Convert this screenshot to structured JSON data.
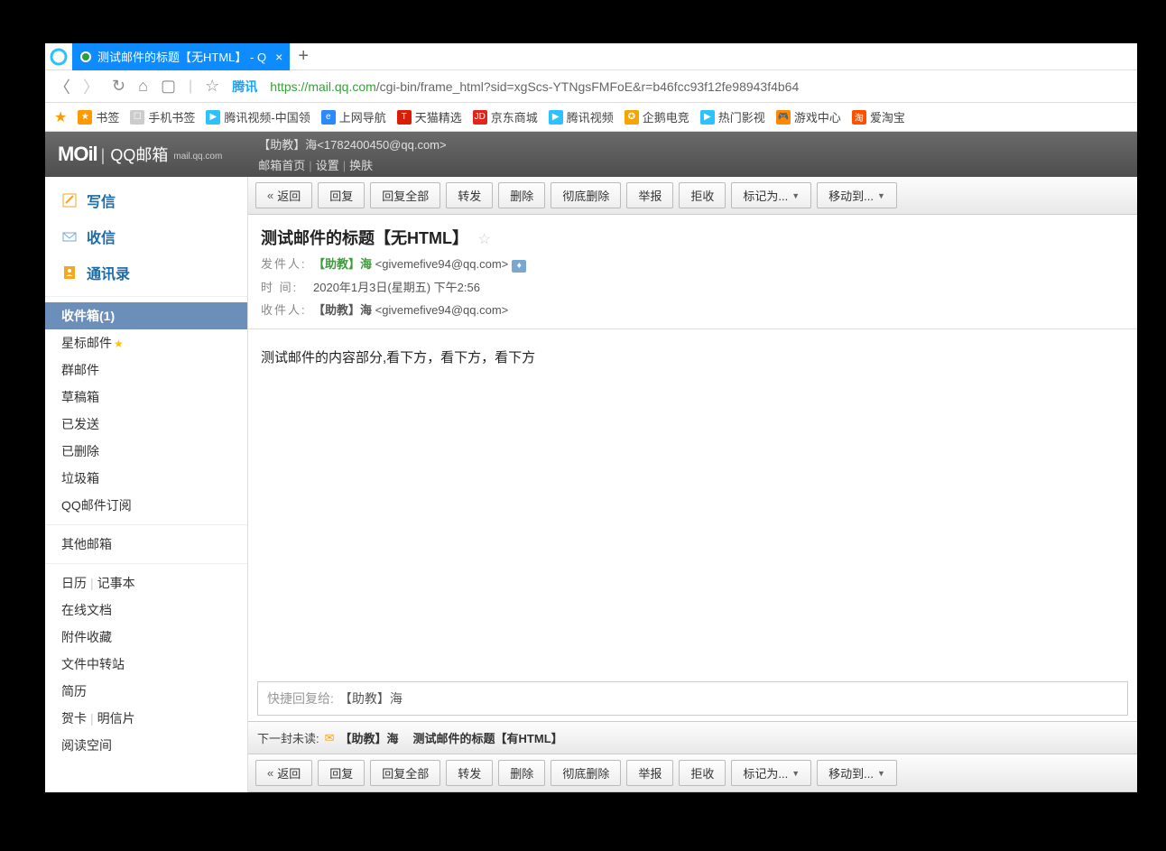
{
  "browser": {
    "tab_title": "测试邮件的标题【无HTML】 - Q",
    "url_badge": "腾讯",
    "url_scheme": "https://",
    "url_host": "mail.qq.com",
    "url_path": "/cgi-bin/frame_html?sid=xgScs-YTNgsFMFoE&r=b46fcc93f12fe98943f4b64"
  },
  "bookmarks": [
    {
      "label": "书签",
      "color": "#f90",
      "glyph": "★"
    },
    {
      "label": "手机书签",
      "color": "#ccc",
      "glyph": "☐"
    },
    {
      "label": "腾讯视频-中国领",
      "color": "#2ec1ff",
      "glyph": "▶"
    },
    {
      "label": "上网导航",
      "color": "#2a89ff",
      "glyph": "e"
    },
    {
      "label": "天猫精选",
      "color": "#d81e06",
      "glyph": "T"
    },
    {
      "label": "京东商城",
      "color": "#e1251b",
      "glyph": "JD"
    },
    {
      "label": "腾讯视频",
      "color": "#2ec1ff",
      "glyph": "▶"
    },
    {
      "label": "企鹅电竞",
      "color": "#f6a400",
      "glyph": "✪"
    },
    {
      "label": "热门影视",
      "color": "#2ec1ff",
      "glyph": "▶"
    },
    {
      "label": "游戏中心",
      "color": "#ff8a00",
      "glyph": "🎮"
    },
    {
      "label": "爱淘宝",
      "color": "#ff5000",
      "glyph": "淘"
    }
  ],
  "header": {
    "logo": "MOil",
    "logo_sub": "QQ邮箱",
    "logo_domain": "mail.qq.com",
    "user": "【助教】海<1782400450@qq.com>",
    "links": [
      "邮箱首页",
      "设置",
      "换肤"
    ]
  },
  "sidebar": {
    "actions": [
      {
        "label": "写信",
        "icon": "compose"
      },
      {
        "label": "收信",
        "icon": "inbox"
      },
      {
        "label": "通讯录",
        "icon": "contacts"
      }
    ],
    "folders": [
      {
        "label": "收件箱(1)",
        "selected": true
      },
      {
        "label": "星标邮件",
        "star": true
      },
      {
        "label": "群邮件"
      },
      {
        "label": "草稿箱"
      },
      {
        "label": "已发送"
      },
      {
        "label": "已删除"
      },
      {
        "label": "垃圾箱"
      },
      {
        "label": "QQ邮件订阅"
      }
    ],
    "other_mailbox": "其他邮箱",
    "tools1": [
      "日历",
      "记事本"
    ],
    "tools2": [
      "在线文档",
      "附件收藏",
      "文件中转站",
      "简历"
    ],
    "tools3": [
      "贺卡",
      "明信片"
    ],
    "tools4": [
      "阅读空间"
    ]
  },
  "toolbar": {
    "back": "返回",
    "reply": "回复",
    "reply_all": "回复全部",
    "forward": "转发",
    "delete": "删除",
    "delete_forever": "彻底删除",
    "report": "举报",
    "reject": "拒收",
    "mark_as": "标记为...",
    "move_to": "移动到..."
  },
  "message": {
    "subject": "测试邮件的标题【无HTML】",
    "from_label": "发件人:",
    "from_name": "【助教】海",
    "from_addr": "<givemefive94@qq.com>",
    "date_label": "时   间:",
    "date": "2020年1月3日(星期五) 下午2:56",
    "to_label": "收件人:",
    "to_name": "【助教】海",
    "to_addr": "<givemefive94@qq.com>",
    "body": "测试邮件的内容部分,看下方，看下方，看下方"
  },
  "quickreply": {
    "label": "快捷回复给:",
    "name": "【助教】海"
  },
  "next_unread": {
    "label": "下一封未读:",
    "sender": "【助教】海",
    "subject": "测试邮件的标题【有HTML】"
  }
}
